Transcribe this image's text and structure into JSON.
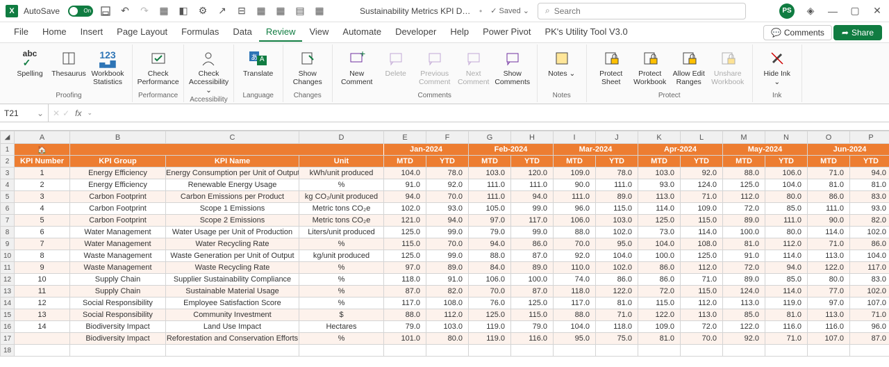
{
  "titlebar": {
    "autosave_label": "AutoSave",
    "autosave_on": "On",
    "doc_title": "Sustainability Metrics KPI Dashb...",
    "saved_status": "Saved",
    "search_placeholder": "Search",
    "avatar": "PS"
  },
  "tabs": [
    "File",
    "Home",
    "Insert",
    "Page Layout",
    "Formulas",
    "Data",
    "Review",
    "View",
    "Automate",
    "Developer",
    "Help",
    "Power Pivot",
    "PK's Utility Tool V3.0"
  ],
  "active_tab": "Review",
  "comments_btn": "Comments",
  "share_btn": "Share",
  "ribbon": {
    "groups": [
      {
        "label": "Proofing",
        "items": [
          {
            "icon": "abc",
            "label": "Spelling"
          },
          {
            "icon": "book",
            "label": "Thesaurus"
          },
          {
            "icon": "stats",
            "label": "Workbook Statistics"
          }
        ]
      },
      {
        "label": "Performance",
        "items": [
          {
            "icon": "check",
            "label": "Check Performance"
          }
        ]
      },
      {
        "label": "Accessibility",
        "items": [
          {
            "icon": "person",
            "label": "Check Accessibility ⌄"
          }
        ]
      },
      {
        "label": "Language",
        "items": [
          {
            "icon": "translate",
            "label": "Translate"
          }
        ]
      },
      {
        "label": "Changes",
        "items": [
          {
            "icon": "pencil",
            "label": "Show Changes"
          }
        ]
      },
      {
        "label": "Comments",
        "items": [
          {
            "icon": "newcom",
            "label": "New Comment"
          },
          {
            "icon": "delcom",
            "label": "Delete",
            "disabled": true
          },
          {
            "icon": "prevcom",
            "label": "Previous Comment",
            "disabled": true
          },
          {
            "icon": "nextcom",
            "label": "Next Comment",
            "disabled": true
          },
          {
            "icon": "showcom",
            "label": "Show Comments"
          }
        ]
      },
      {
        "label": "Notes",
        "items": [
          {
            "icon": "notes",
            "label": "Notes ⌄"
          }
        ]
      },
      {
        "label": "Protect",
        "items": [
          {
            "icon": "psheet",
            "label": "Protect Sheet"
          },
          {
            "icon": "pwb",
            "label": "Protect Workbook"
          },
          {
            "icon": "aedit",
            "label": "Allow Edit Ranges"
          },
          {
            "icon": "unshare",
            "label": "Unshare Workbook",
            "disabled": true
          }
        ]
      },
      {
        "label": "Ink",
        "items": [
          {
            "icon": "hideink",
            "label": "Hide Ink ⌄"
          }
        ]
      }
    ]
  },
  "name_box": "T21",
  "columns": [
    "A",
    "B",
    "C",
    "D",
    "E",
    "F",
    "G",
    "H",
    "I",
    "J",
    "K",
    "L",
    "M",
    "N",
    "O",
    "P"
  ],
  "months": [
    "Jan-2024",
    "Feb-2024",
    "Mar-2024",
    "Apr-2024",
    "May-2024",
    "Jun-2024"
  ],
  "headers": {
    "kpi_num": "KPI Number",
    "kpi_group": "KPI Group",
    "kpi_name": "KPI Name",
    "unit": "Unit",
    "mtd": "MTD",
    "ytd": "YTD"
  },
  "rows": [
    {
      "n": "1",
      "g": "Energy Efficiency",
      "k": "Energy Consumption per Unit of Output",
      "u": "kWh/unit produced",
      "d": [
        "104.0",
        "78.0",
        "103.0",
        "120.0",
        "109.0",
        "78.0",
        "103.0",
        "92.0",
        "88.0",
        "106.0",
        "71.0",
        "94.0"
      ]
    },
    {
      "n": "2",
      "g": "Energy Efficiency",
      "k": "Renewable Energy Usage",
      "u": "%",
      "d": [
        "91.0",
        "92.0",
        "111.0",
        "111.0",
        "90.0",
        "111.0",
        "93.0",
        "124.0",
        "125.0",
        "104.0",
        "81.0",
        "81.0"
      ]
    },
    {
      "n": "3",
      "g": "Carbon Footprint",
      "k": "Carbon Emissions per Product",
      "u": "kg CO₂/unit produced",
      "d": [
        "94.0",
        "70.0",
        "111.0",
        "94.0",
        "111.0",
        "89.0",
        "113.0",
        "71.0",
        "112.0",
        "80.0",
        "86.0",
        "83.0"
      ]
    },
    {
      "n": "4",
      "g": "Carbon Footprint",
      "k": "Scope 1 Emissions",
      "u": "Metric tons CO₂e",
      "d": [
        "102.0",
        "93.0",
        "105.0",
        "99.0",
        "96.0",
        "115.0",
        "114.0",
        "109.0",
        "72.0",
        "85.0",
        "111.0",
        "93.0"
      ]
    },
    {
      "n": "5",
      "g": "Carbon Footprint",
      "k": "Scope 2 Emissions",
      "u": "Metric tons CO₂e",
      "d": [
        "121.0",
        "94.0",
        "97.0",
        "117.0",
        "106.0",
        "103.0",
        "125.0",
        "115.0",
        "89.0",
        "111.0",
        "90.0",
        "82.0"
      ]
    },
    {
      "n": "6",
      "g": "Water Management",
      "k": "Water Usage per Unit of Production",
      "u": "Liters/unit produced",
      "d": [
        "125.0",
        "99.0",
        "79.0",
        "99.0",
        "88.0",
        "102.0",
        "73.0",
        "114.0",
        "100.0",
        "80.0",
        "114.0",
        "102.0"
      ]
    },
    {
      "n": "7",
      "g": "Water Management",
      "k": "Water Recycling Rate",
      "u": "%",
      "d": [
        "115.0",
        "70.0",
        "94.0",
        "86.0",
        "70.0",
        "95.0",
        "104.0",
        "108.0",
        "81.0",
        "112.0",
        "71.0",
        "86.0"
      ]
    },
    {
      "n": "8",
      "g": "Waste Management",
      "k": "Waste Generation per Unit of Output",
      "u": "kg/unit produced",
      "d": [
        "125.0",
        "99.0",
        "88.0",
        "87.0",
        "92.0",
        "104.0",
        "100.0",
        "125.0",
        "91.0",
        "114.0",
        "113.0",
        "104.0"
      ]
    },
    {
      "n": "9",
      "g": "Waste Management",
      "k": "Waste Recycling Rate",
      "u": "%",
      "d": [
        "97.0",
        "89.0",
        "84.0",
        "89.0",
        "110.0",
        "102.0",
        "86.0",
        "112.0",
        "72.0",
        "94.0",
        "122.0",
        "117.0"
      ]
    },
    {
      "n": "10",
      "g": "Supply Chain",
      "k": "Supplier Sustainability Compliance",
      "u": "%",
      "d": [
        "118.0",
        "91.0",
        "106.0",
        "100.0",
        "74.0",
        "86.0",
        "86.0",
        "71.0",
        "89.0",
        "85.0",
        "80.0",
        "83.0"
      ]
    },
    {
      "n": "11",
      "g": "Supply Chain",
      "k": "Sustainable Material Usage",
      "u": "%",
      "d": [
        "87.0",
        "82.0",
        "70.0",
        "87.0",
        "118.0",
        "122.0",
        "72.0",
        "115.0",
        "124.0",
        "114.0",
        "77.0",
        "102.0"
      ]
    },
    {
      "n": "12",
      "g": "Social Responsibility",
      "k": "Employee Satisfaction Score",
      "u": "%",
      "d": [
        "117.0",
        "108.0",
        "76.0",
        "125.0",
        "117.0",
        "81.0",
        "115.0",
        "112.0",
        "113.0",
        "119.0",
        "97.0",
        "107.0"
      ]
    },
    {
      "n": "13",
      "g": "Social Responsibility",
      "k": "Community Investment",
      "u": "$",
      "d": [
        "88.0",
        "112.0",
        "125.0",
        "115.0",
        "88.0",
        "71.0",
        "122.0",
        "113.0",
        "85.0",
        "81.0",
        "113.0",
        "71.0"
      ]
    },
    {
      "n": "14",
      "g": "Biodiversity Impact",
      "k": "Land Use Impact",
      "u": "Hectares",
      "d": [
        "79.0",
        "103.0",
        "119.0",
        "79.0",
        "104.0",
        "118.0",
        "109.0",
        "72.0",
        "122.0",
        "116.0",
        "116.0",
        "96.0"
      ]
    },
    {
      "n": "",
      "g": "Biodiversity Impact",
      "k": "Reforestation and Conservation Efforts",
      "u": "%",
      "d": [
        "101.0",
        "80.0",
        "119.0",
        "116.0",
        "95.0",
        "75.0",
        "81.0",
        "70.0",
        "92.0",
        "71.0",
        "107.0",
        "87.0"
      ]
    }
  ]
}
